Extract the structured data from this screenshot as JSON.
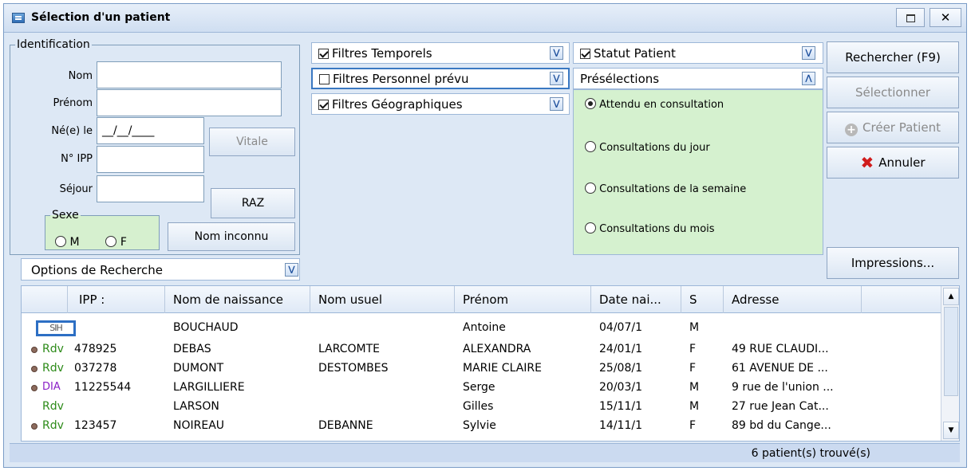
{
  "window": {
    "title": "Sélection d'un patient",
    "maximize": "□",
    "close": "✕"
  },
  "identification": {
    "legend": "Identification",
    "nom_label": "Nom",
    "nom_value": "",
    "prenom_label": "Prénom",
    "prenom_value": "",
    "ne_label": "Né(e) le",
    "ne_value": "__/__/____",
    "ipp_label": "N° IPP",
    "ipp_value": "",
    "sejour_label": "Séjour",
    "sejour_value": "",
    "vitale_button": "Vitale",
    "raz_button": "RAZ",
    "nom_inconnu_button": "Nom inconnu",
    "sexe": {
      "legend": "Sexe",
      "m": "M",
      "f": "F"
    }
  },
  "options_recherche": "Options de Recherche",
  "filters": {
    "temporels": "Filtres Temporels",
    "personnel": "Filtres Personnel prévu",
    "geographiques": "Filtres Géographiques",
    "statut_patient": "Statut Patient",
    "preselections": "Présélections"
  },
  "preselections": {
    "items": [
      "Attendu en consultation",
      "Consultations du jour",
      "Consultations de la semaine",
      "Consultations du mois"
    ],
    "selected_index": 0
  },
  "actions": {
    "rechercher": "Rechercher (F9)",
    "selectionner": "Sélectionner",
    "creer_patient": "Créer Patient",
    "annuler": "Annuler",
    "impressions": "Impressions..."
  },
  "table": {
    "columns": [
      "IPP :",
      "Nom de naissance",
      "Nom usuel",
      "Prénom",
      "Date nai...",
      "S",
      "Adresse",
      ""
    ],
    "rows": [
      {
        "tag": "SIH",
        "ipp": "",
        "nom_naissance": "BOUCHAUD",
        "nom_usuel": "",
        "prenom": "Antoine",
        "date": "04/07/1",
        "sexe": "M",
        "adresse": ""
      },
      {
        "tag": "Rdv",
        "ipp": "478925",
        "nom_naissance": "DEBAS",
        "nom_usuel": "LARCOMTE",
        "prenom": "ALEXANDRA",
        "date": "24/01/1",
        "sexe": "F",
        "adresse": "49 RUE CLAUDI..."
      },
      {
        "tag": "Rdv",
        "ipp": "037278",
        "nom_naissance": "DUMONT",
        "nom_usuel": "DESTOMBES",
        "prenom": "MARIE CLAIRE",
        "date": "25/08/1",
        "sexe": "F",
        "adresse": "61 AVENUE DE ..."
      },
      {
        "tag": "DIA",
        "ipp": "11225544",
        "nom_naissance": "LARGILLIERE",
        "nom_usuel": "",
        "prenom": "Serge",
        "date": "20/03/1",
        "sexe": "M",
        "adresse": "9 rue de l'union ..."
      },
      {
        "tag": "Rdv",
        "ipp": "",
        "nom_naissance": "LARSON",
        "nom_usuel": "",
        "prenom": "Gilles",
        "date": "15/11/1",
        "sexe": "M",
        "adresse": "27 rue Jean Cat..."
      },
      {
        "tag": "Rdv",
        "ipp": "123457",
        "nom_naissance": "NOIREAU",
        "nom_usuel": "DEBANNE",
        "prenom": "Sylvie",
        "date": "14/11/1",
        "sexe": "F",
        "adresse": "89 bd du Cange..."
      }
    ]
  },
  "status": "6 patient(s) trouvé(s)"
}
